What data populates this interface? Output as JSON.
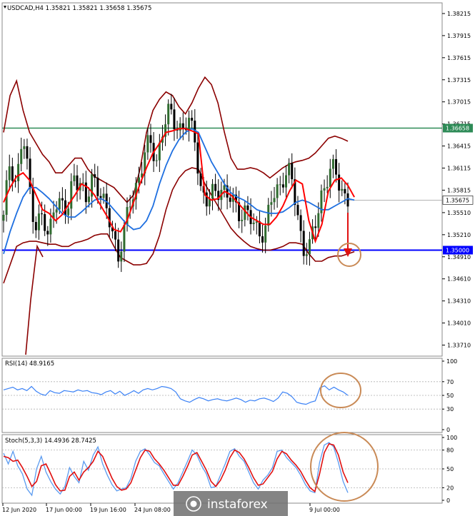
{
  "chart_data": [
    {
      "type": "candlestick",
      "title": "USDCAD,H4  1.35821 1.35821 1.35658 1.35675",
      "ylim": [
        1.3356,
        1.3836
      ],
      "y_ticks": [
        "1.38215",
        "1.37915",
        "1.37615",
        "1.37315",
        "1.37015",
        "1.36715",
        "1.36415",
        "1.36115",
        "1.35815",
        "1.35510",
        "1.35210",
        "1.34910",
        "1.34610",
        "1.34310",
        "1.34010",
        "1.33710"
      ],
      "x_ticks": [
        "12 Jun 2020",
        "17 Jun 00:00",
        "19 Jun 16:00",
        "24 Jun 08:00",
        "9 Jul 00:00"
      ],
      "price_tag": "1.35675",
      "levels": [
        {
          "label": "1.36658",
          "value": 1.36658,
          "color": "#2e8b57"
        },
        {
          "label": "1.35000",
          "value": 1.35,
          "color": "#0000ff"
        }
      ],
      "close_path": [
        1.354,
        1.3625,
        1.359,
        1.3655,
        1.359,
        1.3535,
        1.3545,
        1.351,
        1.3575,
        1.356,
        1.3545,
        1.361,
        1.359,
        1.356,
        1.3605,
        1.3585,
        1.355,
        1.353,
        1.3495,
        1.3525,
        1.357,
        1.3595,
        1.3625,
        1.3645,
        1.3625,
        1.3665,
        1.3685,
        1.3675,
        1.3665,
        1.367,
        1.3655,
        1.358,
        1.356,
        1.358,
        1.359,
        1.357,
        1.3565,
        1.3555,
        1.355,
        1.3535,
        1.353,
        1.3525,
        1.3565,
        1.3585,
        1.3605,
        1.36,
        1.3555,
        1.3505,
        1.35,
        1.354,
        1.3585,
        1.36,
        1.3608,
        1.3585,
        1.3568
      ],
      "bands": {
        "red_ma": [
          1.3565,
          1.3585,
          1.36,
          1.3605,
          1.3595,
          1.3575,
          1.3555,
          1.355,
          1.354,
          1.3548,
          1.3562,
          1.3575,
          1.359,
          1.3585,
          1.3575,
          1.356,
          1.3545,
          1.3528,
          1.3525,
          1.354,
          1.3565,
          1.359,
          1.3612,
          1.3632,
          1.3645,
          1.366,
          1.3662,
          1.3665,
          1.3665,
          1.3662,
          1.3658,
          1.3575,
          1.3568,
          1.357,
          1.358,
          1.3575,
          1.3565,
          1.3555,
          1.3545,
          1.354,
          1.3535,
          1.3535,
          1.3545,
          1.356,
          1.358,
          1.3595,
          1.359,
          1.354,
          1.3512,
          1.3535,
          1.358,
          1.3595,
          1.3598,
          1.3588,
          1.3572
        ],
        "blue_ma": [
          1.3495,
          1.3525,
          1.355,
          1.3572,
          1.3585,
          1.3585,
          1.3578,
          1.357,
          1.356,
          1.355,
          1.3545,
          1.3545,
          1.3552,
          1.356,
          1.3568,
          1.357,
          1.3565,
          1.3555,
          1.3545,
          1.3535,
          1.3528,
          1.353,
          1.354,
          1.356,
          1.359,
          1.3615,
          1.3635,
          1.365,
          1.366,
          1.3665,
          1.366,
          1.364,
          1.362,
          1.3605,
          1.359,
          1.3578,
          1.3572,
          1.3568,
          1.3562,
          1.3555,
          1.3552,
          1.355,
          1.355,
          1.3552,
          1.3558,
          1.3565,
          1.3568,
          1.3565,
          1.356,
          1.3555,
          1.3555,
          1.356,
          1.3565,
          1.357,
          1.3568
        ],
        "upper": [
          1.366,
          1.371,
          1.373,
          1.369,
          1.366,
          1.3645,
          1.363,
          1.362,
          1.3605,
          1.3605,
          1.3615,
          1.3625,
          1.3625,
          1.361,
          1.36,
          1.3595,
          1.359,
          1.3585,
          1.3575,
          1.3565,
          1.3575,
          1.361,
          1.366,
          1.369,
          1.3705,
          1.3715,
          1.371,
          1.3695,
          1.3685,
          1.37,
          1.372,
          1.3735,
          1.3725,
          1.37,
          1.366,
          1.3625,
          1.361,
          1.361,
          1.3612,
          1.361,
          1.3605,
          1.3598,
          1.3605,
          1.3612,
          1.3617,
          1.362,
          1.3622,
          1.3625,
          1.3632,
          1.3642,
          1.3652,
          1.3655,
          1.3652,
          1.3648
        ],
        "lower": [
          1.3455,
          1.348,
          1.3505,
          1.351,
          1.3512,
          1.3512,
          1.351,
          1.3508,
          1.3508,
          1.3505,
          1.3505,
          1.351,
          1.3512,
          1.3515,
          1.352,
          1.3522,
          1.3522,
          1.3505,
          1.349,
          1.3485,
          1.348,
          1.348,
          1.3482,
          1.3495,
          1.352,
          1.3555,
          1.3582,
          1.3598,
          1.3608,
          1.3612,
          1.361,
          1.359,
          1.3575,
          1.356,
          1.3545,
          1.353,
          1.352,
          1.3512,
          1.3505,
          1.3502,
          1.35,
          1.35,
          1.3502,
          1.3505,
          1.351,
          1.351,
          1.3508,
          1.3495,
          1.3485,
          1.3485,
          1.349,
          1.3492,
          1.3492,
          1.3495,
          1.3498
        ]
      }
    },
    {
      "type": "line",
      "title": "RSI(14) 48.9165",
      "ylim": [
        0,
        100
      ],
      "y_ticks": [
        "100",
        "70",
        "50",
        "30",
        "0"
      ],
      "values": [
        58,
        60,
        62,
        58,
        60,
        57,
        63,
        56,
        52,
        50,
        57,
        54,
        53,
        57,
        56,
        55,
        58,
        56,
        57,
        54,
        53,
        51,
        55,
        57,
        52,
        56,
        50,
        53,
        57,
        53,
        58,
        60,
        58,
        60,
        63,
        62,
        60,
        55,
        45,
        42,
        40,
        44,
        47,
        45,
        42,
        44,
        45,
        43,
        42,
        44,
        46,
        44,
        40,
        43,
        42,
        45,
        46,
        44,
        41,
        46,
        55,
        53,
        48,
        40,
        38,
        37,
        40,
        42,
        61,
        64,
        58,
        62,
        58,
        55,
        50
      ]
    },
    {
      "type": "line",
      "title": "Stoch(5,3,3) 14.4936 28.7425",
      "ylim": [
        0,
        100
      ],
      "y_ticks": [
        "100",
        "80",
        "50",
        "20",
        "0"
      ],
      "series": [
        {
          "values": [
            75,
            58,
            78,
            55,
            42,
            18,
            8,
            50,
            70,
            45,
            30,
            18,
            10,
            22,
            52,
            38,
            28,
            62,
            48,
            72,
            85,
            58,
            40,
            25,
            15,
            18,
            20,
            35,
            62,
            78,
            82,
            72,
            60,
            55,
            42,
            30,
            18,
            28,
            45,
            62,
            80,
            72,
            55,
            42,
            20,
            22,
            40,
            58,
            78,
            82,
            70,
            62,
            45,
            28,
            18,
            32,
            40,
            52,
            78,
            80,
            68,
            60,
            52,
            40,
            25,
            15,
            12,
            60,
            88,
            92,
            85,
            60,
            30,
            12
          ]
        },
        {
          "values": [
            70,
            68,
            62,
            64,
            52,
            38,
            22,
            30,
            55,
            58,
            42,
            25,
            15,
            16,
            38,
            45,
            32,
            45,
            52,
            62,
            78,
            70,
            52,
            35,
            22,
            16,
            18,
            28,
            48,
            68,
            80,
            78,
            66,
            58,
            48,
            36,
            24,
            24,
            38,
            54,
            72,
            76,
            62,
            48,
            30,
            22,
            32,
            48,
            68,
            80,
            76,
            66,
            52,
            36,
            24,
            26,
            36,
            46,
            66,
            78,
            74,
            64,
            56,
            46,
            32,
            20,
            14,
            42,
            76,
            90,
            88,
            72,
            45,
            28
          ]
        }
      ]
    }
  ],
  "watermark": "instaforex"
}
